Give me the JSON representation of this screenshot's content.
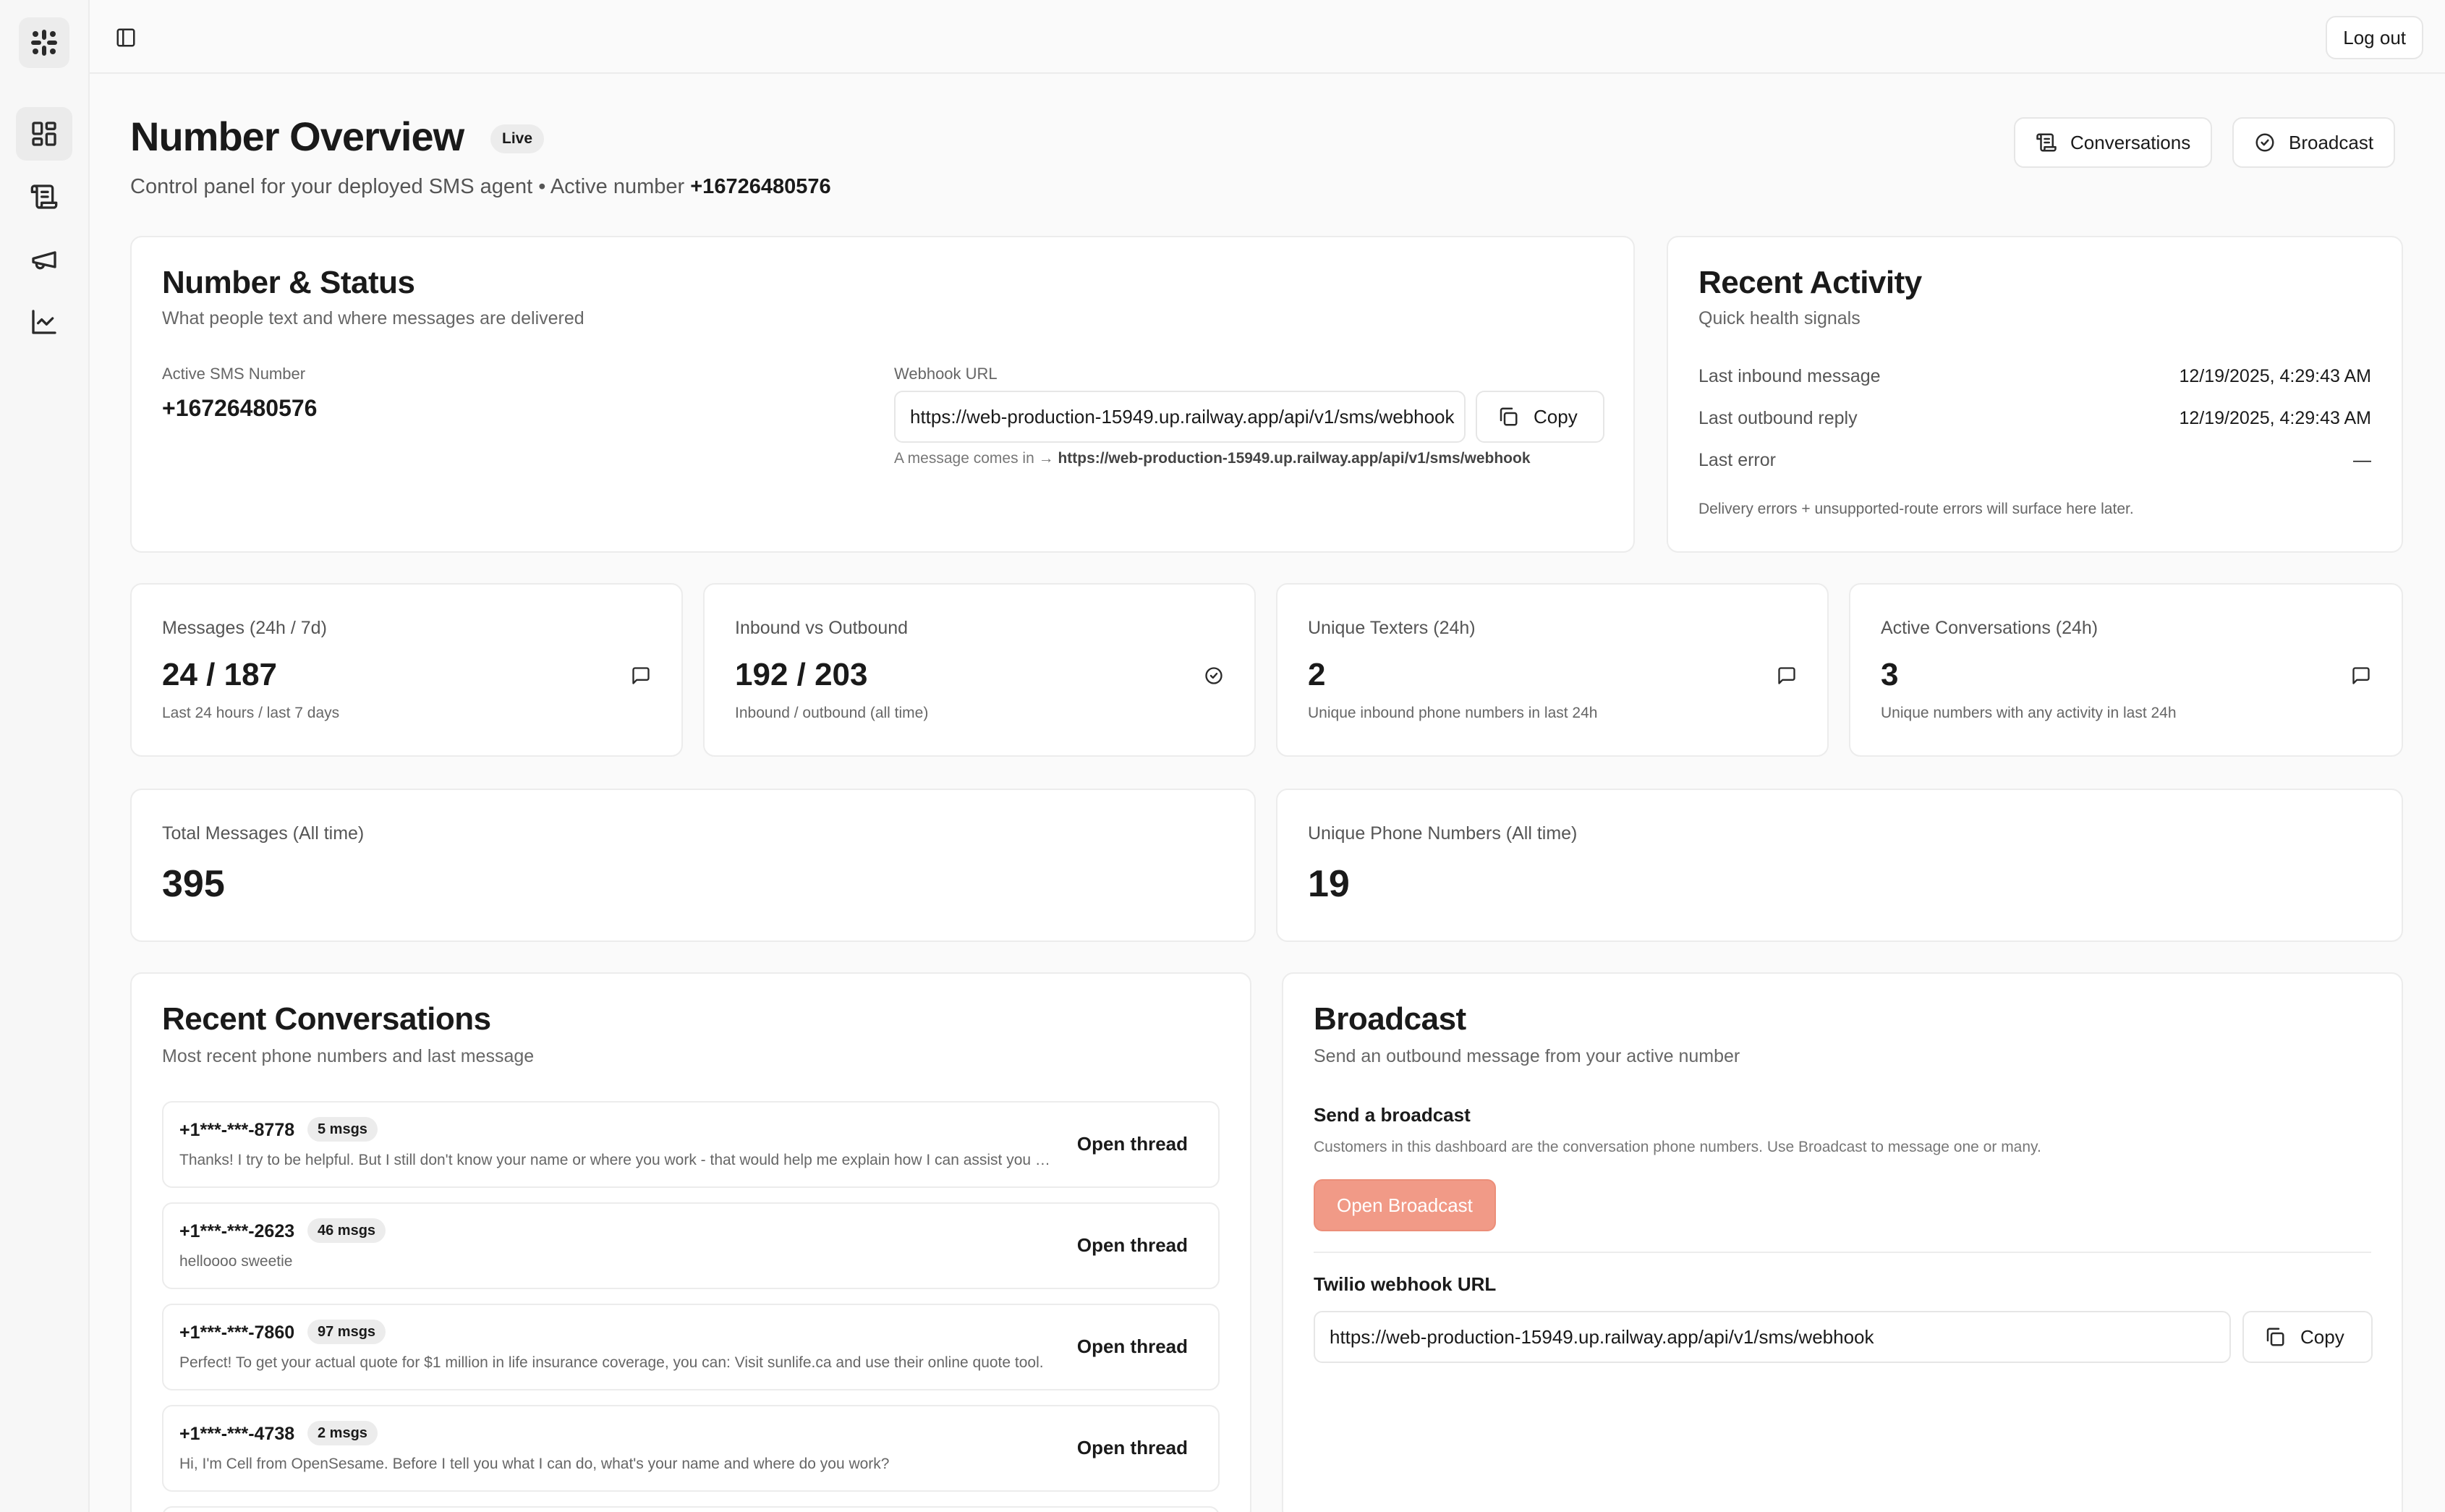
{
  "app": {
    "logout_label": "Log out"
  },
  "header": {
    "title": "Number Overview",
    "badge": "Live",
    "subtitle_prefix": "Control panel for your deployed SMS agent • Active number ",
    "subtitle_number": "+16726480576",
    "buttons": {
      "conversations": "Conversations",
      "broadcast": "Broadcast"
    }
  },
  "number_status": {
    "title": "Number & Status",
    "subtitle": "What people text and where messages are delivered",
    "active_label": "Active SMS Number",
    "active_value": "+16726480576",
    "webhook_label": "Webhook URL",
    "webhook_value": "https://web-production-15949.up.railway.app/api/v1/sms/webhook",
    "copy_label": "Copy",
    "hint_prefix": "A message comes in → ",
    "hint_url": "https://web-production-15949.up.railway.app/api/v1/sms/webhook"
  },
  "recent_activity": {
    "title": "Recent Activity",
    "subtitle": "Quick health signals",
    "rows": [
      {
        "label": "Last inbound message",
        "value": "12/19/2025, 4:29:43 AM"
      },
      {
        "label": "Last outbound reply",
        "value": "12/19/2025, 4:29:43 AM"
      },
      {
        "label": "Last error",
        "value": "—"
      }
    ],
    "note": "Delivery errors + unsupported-route errors will surface here later."
  },
  "stats": [
    {
      "label": "Messages (24h / 7d)",
      "value": "24 / 187",
      "sub": "Last 24 hours / last 7 days",
      "icon": "message-icon"
    },
    {
      "label": "Inbound vs Outbound",
      "value": "192 / 203",
      "sub": "Inbound / outbound (all time)",
      "icon": "check-circle-icon"
    },
    {
      "label": "Unique Texters (24h)",
      "value": "2",
      "sub": "Unique inbound phone numbers in last 24h",
      "icon": "message-icon"
    },
    {
      "label": "Active Conversations (24h)",
      "value": "3",
      "sub": "Unique numbers with any activity in last 24h",
      "icon": "message-icon"
    }
  ],
  "totals": [
    {
      "label": "Total Messages (All time)",
      "value": "395"
    },
    {
      "label": "Unique Phone Numbers (All time)",
      "value": "19"
    }
  ],
  "recent_conversations": {
    "title": "Recent Conversations",
    "subtitle": "Most recent phone numbers and last message",
    "open_label": "Open thread",
    "items": [
      {
        "phone": "+1***-***-8778",
        "count": "5 msgs",
        "message": "Thanks! I try to be helpful. But I still don't know your name or where you work - that would help me explain how I can assist you better."
      },
      {
        "phone": "+1***-***-2623",
        "count": "46 msgs",
        "message": "helloooo sweetie"
      },
      {
        "phone": "+1***-***-7860",
        "count": "97 msgs",
        "message": "Perfect! To get your actual quote for $1 million in life insurance coverage, you can: Visit sunlife.ca and use their online quote tool."
      },
      {
        "phone": "+1***-***-4738",
        "count": "2 msgs",
        "message": "Hi, I'm Cell from OpenSesame. Before I tell you what I can do, what's your name and where do you work?"
      }
    ]
  },
  "broadcast": {
    "title": "Broadcast",
    "subtitle": "Send an outbound message from your active number",
    "send_heading": "Send a broadcast",
    "send_desc": "Customers in this dashboard are the conversation phone numbers. Use Broadcast to message one or many.",
    "open_button": "Open Broadcast",
    "webhook_heading": "Twilio webhook URL",
    "webhook_value": "https://web-production-15949.up.railway.app/api/v1/sms/webhook",
    "copy_label": "Copy"
  },
  "colors": {
    "accent": "#f19a87",
    "border": "#ececec",
    "background": "#fafafa"
  }
}
